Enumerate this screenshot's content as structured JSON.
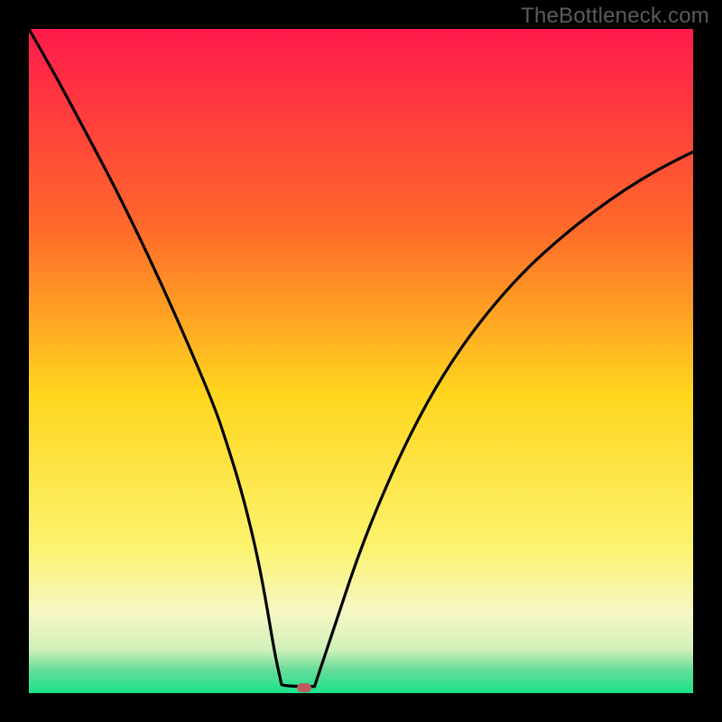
{
  "watermark": {
    "text": "TheBottleneck.com"
  },
  "chart_data": {
    "type": "line",
    "title": "",
    "xlabel": "",
    "ylabel": "",
    "xlim": [
      0,
      100
    ],
    "ylim": [
      0,
      100
    ],
    "grid": false,
    "legend": false,
    "gradient_stops": [
      {
        "offset": 0,
        "color": "#ff1a4c"
      },
      {
        "offset": 0.3,
        "color": "#ff6a2a"
      },
      {
        "offset": 0.55,
        "color": "#ffd61e"
      },
      {
        "offset": 0.78,
        "color": "#fcf36e"
      },
      {
        "offset": 0.88,
        "color": "#f6f7c6"
      },
      {
        "offset": 0.935,
        "color": "#d0f0b8"
      },
      {
        "offset": 0.965,
        "color": "#66dd99"
      },
      {
        "offset": 1.0,
        "color": "#19e28b"
      }
    ],
    "series": [
      {
        "name": "left-branch",
        "x": [
          0,
          4,
          8,
          12,
          16,
          20,
          24,
          28,
          30,
          32,
          34,
          35.5,
          37,
          38
        ],
        "values": [
          100,
          93,
          85.5,
          78,
          70,
          61.5,
          52.5,
          43,
          37,
          30.5,
          22.5,
          15,
          6,
          1.5
        ]
      },
      {
        "name": "flat",
        "x": [
          38,
          40,
          42,
          43
        ],
        "values": [
          1.2,
          1.0,
          1.0,
          1.0
        ]
      },
      {
        "name": "right-branch",
        "x": [
          43,
          46,
          50,
          55,
          60,
          65,
          70,
          75,
          80,
          85,
          90,
          95,
          100
        ],
        "values": [
          1.0,
          10,
          22,
          34,
          44,
          52,
          58.5,
          64,
          68.5,
          72.5,
          76,
          79,
          81.5
        ]
      }
    ],
    "marker": {
      "x": 41.5,
      "y": 0.8,
      "color": "#c15a5a"
    }
  }
}
